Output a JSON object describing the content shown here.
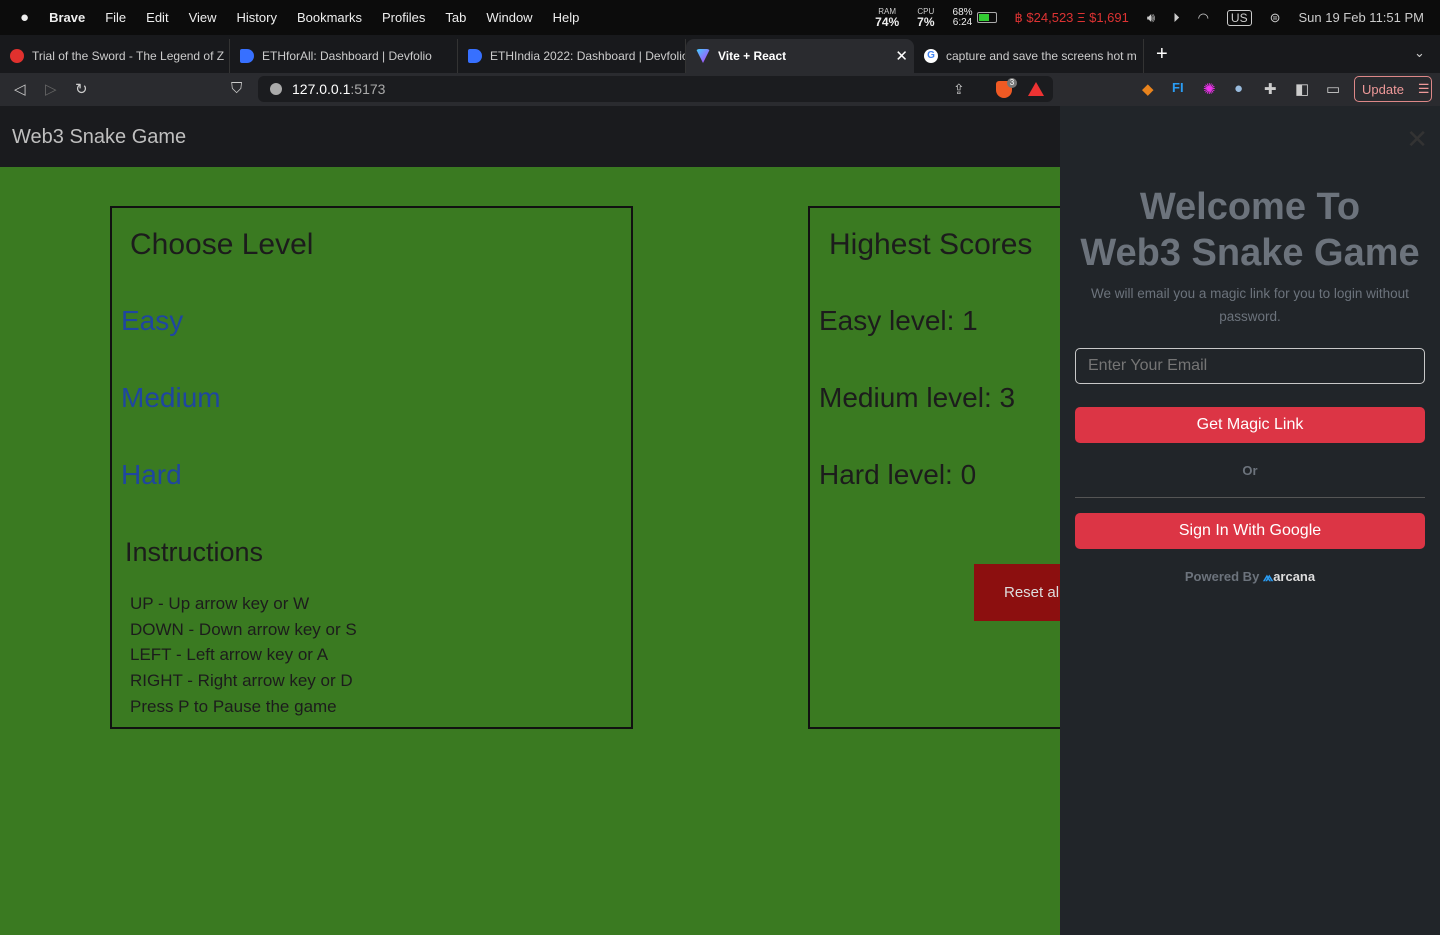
{
  "menubar": {
    "app": "Brave",
    "items": [
      "File",
      "Edit",
      "View",
      "History",
      "Bookmarks",
      "Profiles",
      "Tab",
      "Window",
      "Help"
    ],
    "ram_label": "RAM",
    "ram": "74%",
    "cpu_label": "CPU",
    "cpu": "7%",
    "battery_pct": "68%",
    "battery_time": "6:24",
    "btc": "฿ $24,523",
    "eth": "Ξ $1,691",
    "keyboard": "US",
    "datetime": "Sun 19 Feb  11:51 PM"
  },
  "tabs": [
    {
      "title": "Trial of the Sword - The Legend of Z",
      "color": "#e0312e"
    },
    {
      "title": "ETHforAll: Dashboard | Devfolio",
      "color": "#3770ff"
    },
    {
      "title": "ETHIndia 2022: Dashboard | Devfolio",
      "color": "#3770ff"
    },
    {
      "title": "Vite + React",
      "color": "#a66cff",
      "active": true
    },
    {
      "title": "capture and save the screens hot m",
      "color": "#ffffff"
    }
  ],
  "toolbar": {
    "url_host": "127.0.0.1",
    "url_port": ":5173",
    "brave_badge": "3",
    "update_label": "Update"
  },
  "app": {
    "title": "Web3 Snake Game",
    "choose_level": {
      "heading": "Choose Level",
      "levels": [
        "Easy",
        "Medium",
        "Hard"
      ]
    },
    "instructions": {
      "heading": "Instructions",
      "lines": [
        "UP - Up arrow key or W",
        "DOWN - Down arrow key or S",
        "LEFT - Left arrow key or A",
        "RIGHT - Right arrow key or D",
        "Press P to Pause the game"
      ]
    },
    "scores": {
      "heading": "Highest Scores",
      "lines": [
        "Easy level: 1",
        "Medium level: 3",
        "Hard level: 0"
      ],
      "reset_label": "Reset all"
    }
  },
  "login": {
    "title_line1": "Welcome To",
    "title_line2": "Web3 Snake Game",
    "subtitle": "We will email you a magic link for you to login without password.",
    "email_placeholder": "Enter Your Email",
    "magic_link_label": "Get Magic Link",
    "or": "Or",
    "google_label": "Sign In With Google",
    "powered_by": "Powered By",
    "brand": "arcana",
    "accent": "#dc3545"
  }
}
